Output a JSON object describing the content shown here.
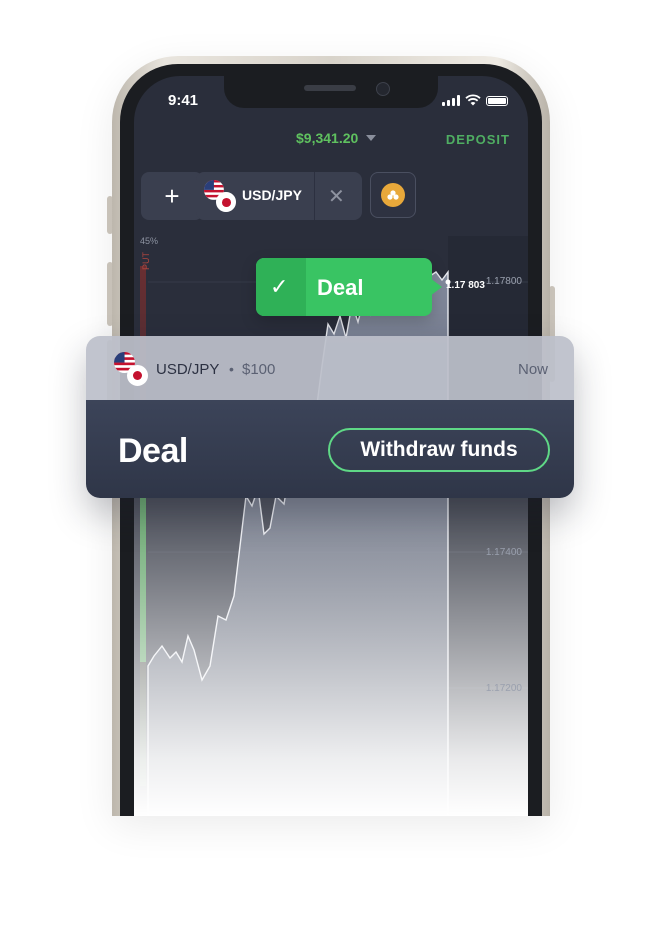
{
  "status_bar": {
    "time": "9:41"
  },
  "header": {
    "balance": "$9,341.20",
    "deposit_label": "DEPOSIT"
  },
  "asset_tabs": {
    "add_label": "+",
    "active_pair": "USD/JPY",
    "close_label": "✕"
  },
  "chart": {
    "put_label": "PUT",
    "put_percent": "45%",
    "current_price_prefix": "1.17",
    "current_price_suffix": "803",
    "levels": [
      "1.17800",
      "1.17400",
      "1.17200"
    ]
  },
  "deal_toast": {
    "label": "Deal"
  },
  "trade_card": {
    "pair": "USD/JPY",
    "separator": "•",
    "amount": "$100",
    "time": "Now",
    "title": "Deal",
    "action_label": "Withdraw funds"
  },
  "colors": {
    "accent_green": "#39c463",
    "balance_green": "#5fc15f",
    "screen_bg": "#2a2e3b",
    "card_dark": "#333a4d"
  }
}
